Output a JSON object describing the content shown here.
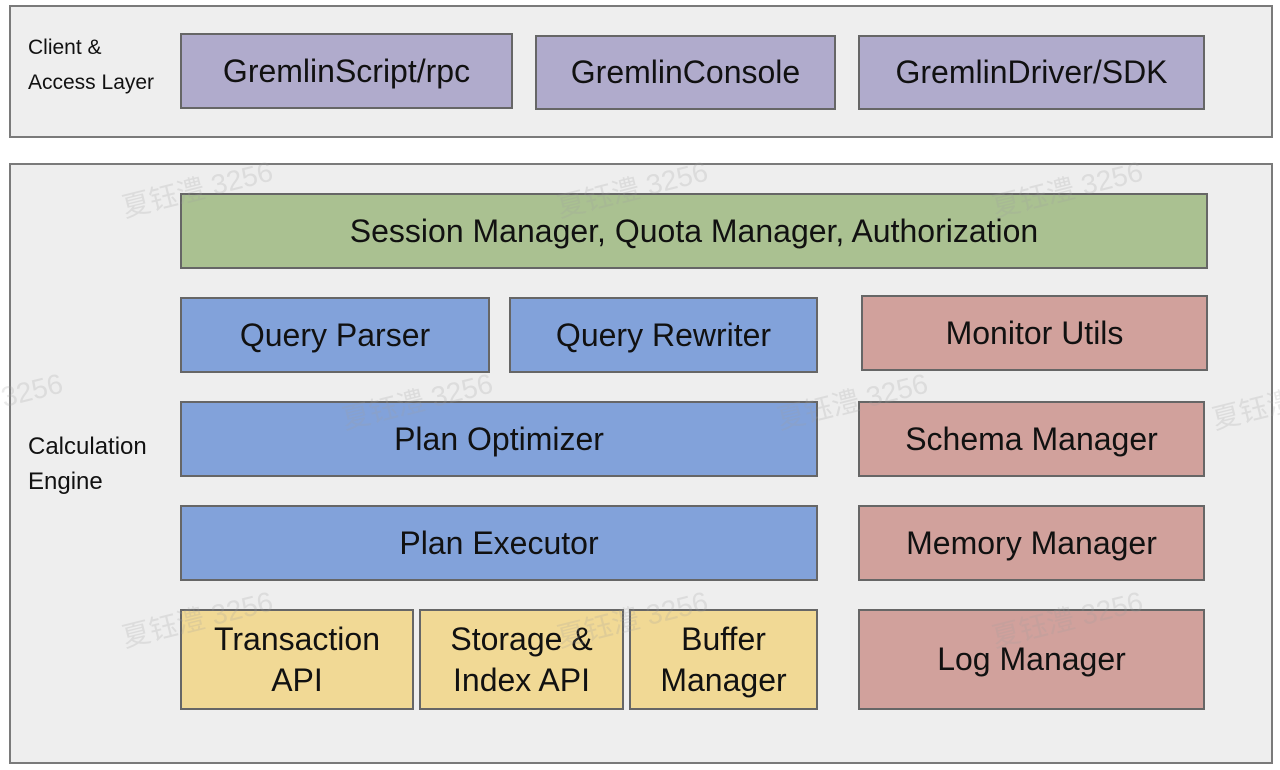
{
  "layers": {
    "client_access": {
      "label_line1": "Client &",
      "label_line2": "Access Layer",
      "components": [
        "GremlinScript/rpc",
        "GremlinConsole",
        "GremlinDriver/SDK"
      ]
    },
    "calculation_engine": {
      "label_line1": "Calculation",
      "label_line2": "Engine",
      "session_bar": "Session Manager, Quota Manager, Authorization",
      "query_parser": "Query Parser",
      "query_rewriter": "Query Rewriter",
      "plan_optimizer": "Plan Optimizer",
      "plan_executor": "Plan Executor",
      "transaction_api": {
        "line1": "Transaction",
        "line2": "API"
      },
      "storage_index_api": {
        "line1": "Storage &",
        "line2": "Index API"
      },
      "buffer_manager": {
        "line1": "Buffer",
        "line2": "Manager"
      },
      "monitor_utils": "Monitor Utils",
      "schema_manager": "Schema Manager",
      "memory_manager": "Memory Manager",
      "log_manager": "Log Manager"
    }
  },
  "colors": {
    "client_components": "#b0abcc",
    "session_bar": "#aac191",
    "query_plan": "#82a2da",
    "managers": "#d1a19c",
    "storage_apis": "#f1d995",
    "layer_bg": "#eeeeee"
  },
  "watermark": "夏钰澧 3256"
}
